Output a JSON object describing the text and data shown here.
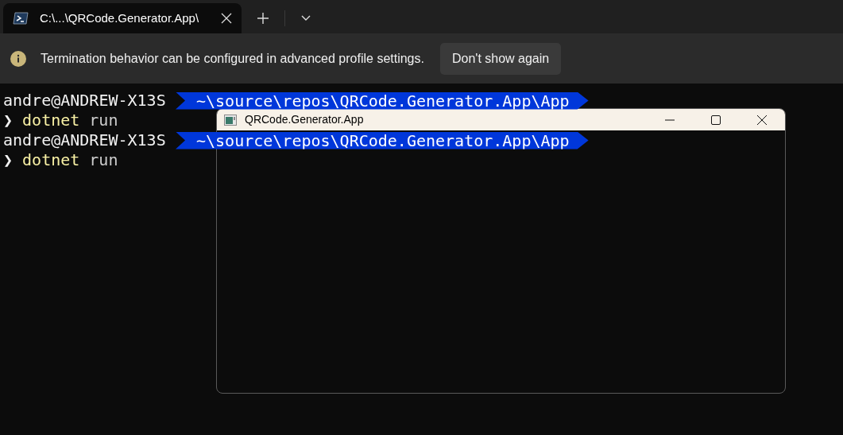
{
  "tabs": [
    {
      "title": "C:\\...\\QRCode.Generator.App\\",
      "selected": true
    }
  ],
  "infobar": {
    "message": "Termination behavior can be configured in advanced profile settings.",
    "button": "Don't show again"
  },
  "terminal": {
    "lines": [
      {
        "kind": "prompt",
        "user": "andre@ANDREW-X13S",
        "path": "~\\source\\repos\\QRCode.Generator.App\\App"
      },
      {
        "kind": "command",
        "chevron": "❯",
        "command": "dotnet",
        "args": "run"
      },
      {
        "kind": "prompt",
        "user": "andre@ANDREW-X13S",
        "path": "~\\source\\repos\\QRCode.Generator.App\\App"
      },
      {
        "kind": "command",
        "chevron": "❯",
        "command": "dotnet",
        "args": "run"
      }
    ]
  },
  "app_window": {
    "title": "QRCode.Generator.App"
  }
}
